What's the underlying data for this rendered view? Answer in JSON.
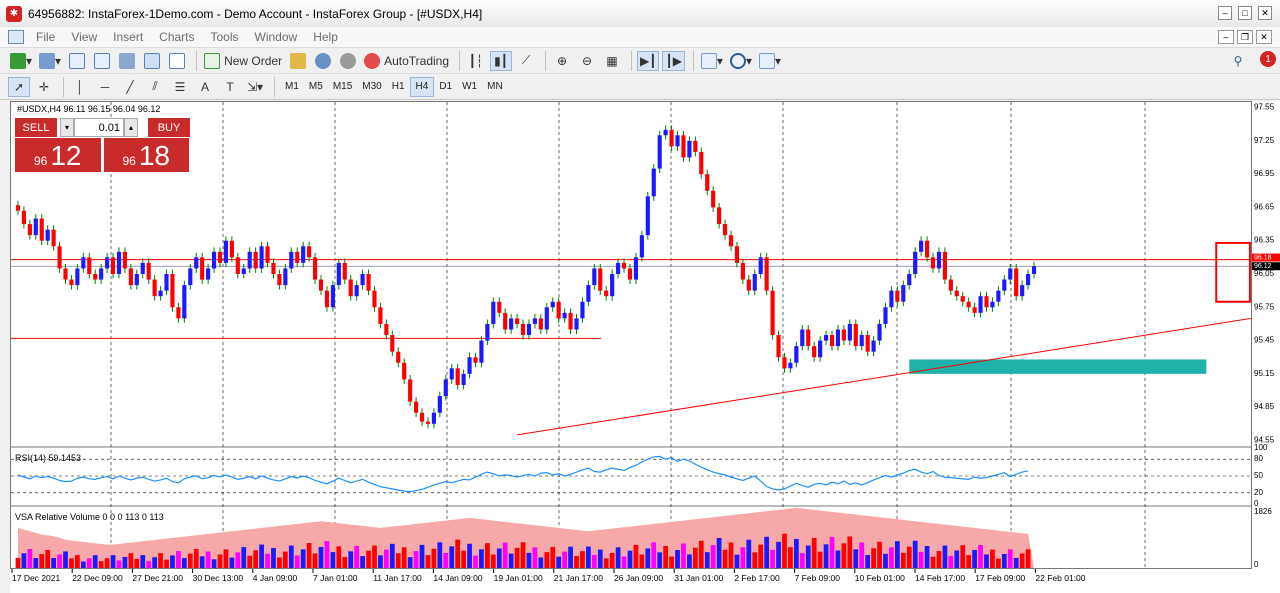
{
  "window": {
    "title": "64956882: InstaForex-1Demo.com - Demo Account - InstaForex Group - [#USDX,H4]",
    "logo_icon": "instaforex-logo-icon"
  },
  "menu": {
    "items": [
      "File",
      "View",
      "Insert",
      "Charts",
      "Tools",
      "Window",
      "Help"
    ],
    "notification_count": "1"
  },
  "toolbar": {
    "new_order_label": "New Order",
    "autotrading_label": "AutoTrading"
  },
  "timeframes": [
    "M1",
    "M5",
    "M15",
    "M30",
    "H1",
    "H4",
    "D1",
    "W1",
    "MN"
  ],
  "active_timeframe": "H4",
  "chart_header": {
    "symbol_ohlc": "#USDX,H4  96.11 96.15 96.04 96.12"
  },
  "one_click": {
    "sell_label": "SELL",
    "buy_label": "BUY",
    "lot": "0.01",
    "spin_down": "▾",
    "spin_up": "▴",
    "sell_small": "96",
    "sell_big": "12",
    "buy_small": "96",
    "buy_big": "18"
  },
  "indicators": {
    "rsi_label": "RSI(14) 59.1453",
    "volume_label": "VSA Relative Volume 0 0 0 113 0 113"
  },
  "chart_data": {
    "type": "candlestick",
    "symbol": "#USDX",
    "timeframe": "H4",
    "price_ticks": [
      "97.55",
      "97.25",
      "96.95",
      "96.65",
      "96.35",
      "96.05",
      "95.75",
      "95.45",
      "95.15",
      "94.85",
      "94.55"
    ],
    "current_bid": "96.12",
    "current_ask": "96.18",
    "rsi_ticks": [
      "100",
      "80",
      "50",
      "20",
      "0"
    ],
    "volume_ticks": [
      "1826",
      "0"
    ],
    "time_labels": [
      "17 Dec 2021",
      "22 Dec 09:00",
      "27 Dec 21:00",
      "30 Dec 13:00",
      "4 Jan 09:00",
      "7 Jan 01:00",
      "11 Jan 17:00",
      "14 Jan 09:00",
      "19 Jan 01:00",
      "21 Jan 17:00",
      "26 Jan 09:00",
      "31 Jan 01:00",
      "2 Feb 17:00",
      "7 Feb 09:00",
      "10 Feb 01:00",
      "14 Feb 17:00",
      "17 Feb 09:00",
      "22 Feb 01:00"
    ],
    "ylim": [
      94.5,
      97.6
    ],
    "closes": [
      96.62,
      96.5,
      96.4,
      96.55,
      96.35,
      96.45,
      96.3,
      96.1,
      96.0,
      95.95,
      96.1,
      96.2,
      96.05,
      96.0,
      96.1,
      96.2,
      96.05,
      96.25,
      96.1,
      95.95,
      96.05,
      96.15,
      96.0,
      95.85,
      95.9,
      96.05,
      95.75,
      95.65,
      95.95,
      96.1,
      96.2,
      96.0,
      96.1,
      96.25,
      96.15,
      96.35,
      96.2,
      96.05,
      96.1,
      96.25,
      96.1,
      96.3,
      96.15,
      96.05,
      95.95,
      96.1,
      96.25,
      96.15,
      96.3,
      96.2,
      96.0,
      95.9,
      95.75,
      95.95,
      96.15,
      96.0,
      95.85,
      95.95,
      96.05,
      95.9,
      95.75,
      95.6,
      95.5,
      95.35,
      95.25,
      95.1,
      94.9,
      94.8,
      94.72,
      94.7,
      94.8,
      94.95,
      95.1,
      95.2,
      95.05,
      95.15,
      95.3,
      95.25,
      95.45,
      95.6,
      95.8,
      95.7,
      95.55,
      95.65,
      95.6,
      95.5,
      95.6,
      95.65,
      95.55,
      95.75,
      95.8,
      95.65,
      95.7,
      95.55,
      95.65,
      95.8,
      95.95,
      96.1,
      95.9,
      95.85,
      96.05,
      96.15,
      96.1,
      96.0,
      96.2,
      96.4,
      96.75,
      97.0,
      97.3,
      97.35,
      97.2,
      97.3,
      97.1,
      97.25,
      97.15,
      96.95,
      96.8,
      96.65,
      96.5,
      96.4,
      96.3,
      96.15,
      96.0,
      95.9,
      96.05,
      96.2,
      95.9,
      95.5,
      95.3,
      95.2,
      95.25,
      95.4,
      95.55,
      95.4,
      95.3,
      95.45,
      95.5,
      95.4,
      95.55,
      95.45,
      95.6,
      95.4,
      95.5,
      95.35,
      95.45,
      95.6,
      95.75,
      95.9,
      95.8,
      95.95,
      96.05,
      96.25,
      96.35,
      96.2,
      96.1,
      96.25,
      96.0,
      95.9,
      95.85,
      95.8,
      95.75,
      95.7,
      95.85,
      95.75,
      95.8,
      95.9,
      96.0,
      96.1,
      95.85,
      95.95,
      96.05,
      96.12
    ],
    "rsi": [
      52,
      48,
      45,
      50,
      47,
      49,
      46,
      42,
      40,
      41,
      46,
      48,
      45,
      44,
      47,
      49,
      45,
      50,
      46,
      43,
      46,
      48,
      44,
      41,
      43,
      46,
      40,
      38,
      45,
      48,
      50,
      45,
      47,
      51,
      48,
      52,
      48,
      44,
      46,
      49,
      45,
      50,
      46,
      43,
      41,
      45,
      49,
      46,
      50,
      47,
      42,
      39,
      36,
      41,
      46,
      42,
      38,
      41,
      44,
      39,
      35,
      31,
      29,
      27,
      25,
      23,
      22,
      24,
      26,
      30,
      34,
      37,
      40,
      38,
      41,
      44,
      43,
      48,
      53,
      57,
      54,
      50,
      52,
      51,
      48,
      51,
      53,
      50,
      55,
      56,
      52,
      54,
      50,
      53,
      57,
      61,
      64,
      58,
      57,
      61,
      64,
      62,
      60,
      65,
      69,
      75,
      80,
      84,
      85,
      80,
      83,
      76,
      80,
      77,
      71,
      66,
      61,
      57,
      54,
      52,
      48,
      45,
      42,
      46,
      50,
      41,
      31,
      27,
      25,
      27,
      32,
      37,
      33,
      30,
      35,
      37,
      34,
      39,
      36,
      41,
      35,
      38,
      34,
      38,
      43,
      47,
      51,
      48,
      52,
      55,
      60,
      62,
      57,
      54,
      58,
      51,
      48,
      47,
      46,
      45,
      44,
      48,
      46,
      47,
      50,
      53,
      56,
      49,
      53,
      57,
      59
    ],
    "volume_bg": [
      1200,
      1150,
      1100,
      1050,
      1000,
      980,
      950,
      900,
      850,
      820,
      800,
      780,
      760,
      740,
      720,
      700,
      700,
      720,
      740,
      760,
      780,
      800,
      820,
      840,
      860,
      880,
      900,
      920,
      940,
      960,
      980,
      1000,
      1020,
      1040,
      1060,
      1080,
      1100,
      1120,
      1140,
      1160,
      1180,
      1200,
      1220,
      1240,
      1260,
      1280,
      1300,
      1320,
      1340,
      1360,
      1380,
      1400,
      1380,
      1360,
      1340,
      1320,
      1300,
      1280,
      1260,
      1240,
      1220,
      1200,
      1220,
      1240,
      1260,
      1280,
      1300,
      1320,
      1340,
      1360,
      1380,
      1400,
      1420,
      1440,
      1460,
      1480,
      1500,
      1480,
      1460,
      1440,
      1420,
      1400,
      1380,
      1360,
      1340,
      1320,
      1300,
      1280,
      1260,
      1240,
      1220,
      1200,
      1180,
      1160,
      1140,
      1120,
      1100,
      1120,
      1140,
      1160,
      1180,
      1200,
      1220,
      1240,
      1260,
      1280,
      1300,
      1320,
      1340,
      1360,
      1380,
      1400,
      1420,
      1440,
      1460,
      1480,
      1500,
      1520,
      1540,
      1560,
      1580,
      1600,
      1620,
      1640,
      1660,
      1680,
      1700,
      1720,
      1740,
      1760,
      1780,
      1800,
      1780,
      1760,
      1740,
      1720,
      1700,
      1680,
      1660,
      1640,
      1620,
      1600,
      1580,
      1560,
      1540,
      1520,
      1500,
      1480,
      1460,
      1440,
      1420,
      1400,
      1380,
      1360,
      1340,
      1320,
      1300,
      1280,
      1260,
      1240,
      1220,
      1200,
      1180,
      1160,
      1140,
      1120,
      1100,
      1080,
      1060,
      1040,
      1020
    ],
    "grid": true,
    "drawn_objects": {
      "horizontal_lines": [
        96.18,
        95.47
      ],
      "trendline": [
        {
          "index": 84,
          "price": 94.6
        },
        {
          "index": 224,
          "price": 95.79
        }
      ],
      "rectangle_support": {
        "from_index": 150,
        "to_index": 200,
        "top": 95.28,
        "bottom": 95.15
      },
      "highlight_box": {
        "from_index": 202,
        "to_index": 207,
        "top": 96.33,
        "bottom": 95.8
      }
    },
    "colors": {
      "up": "#1a1aff",
      "down": "#ff0000",
      "wick": "#008000",
      "support_rect": "#20b2aa",
      "rsi_line": "#1e8fff",
      "volume_bg": "#f7a8a8"
    }
  }
}
